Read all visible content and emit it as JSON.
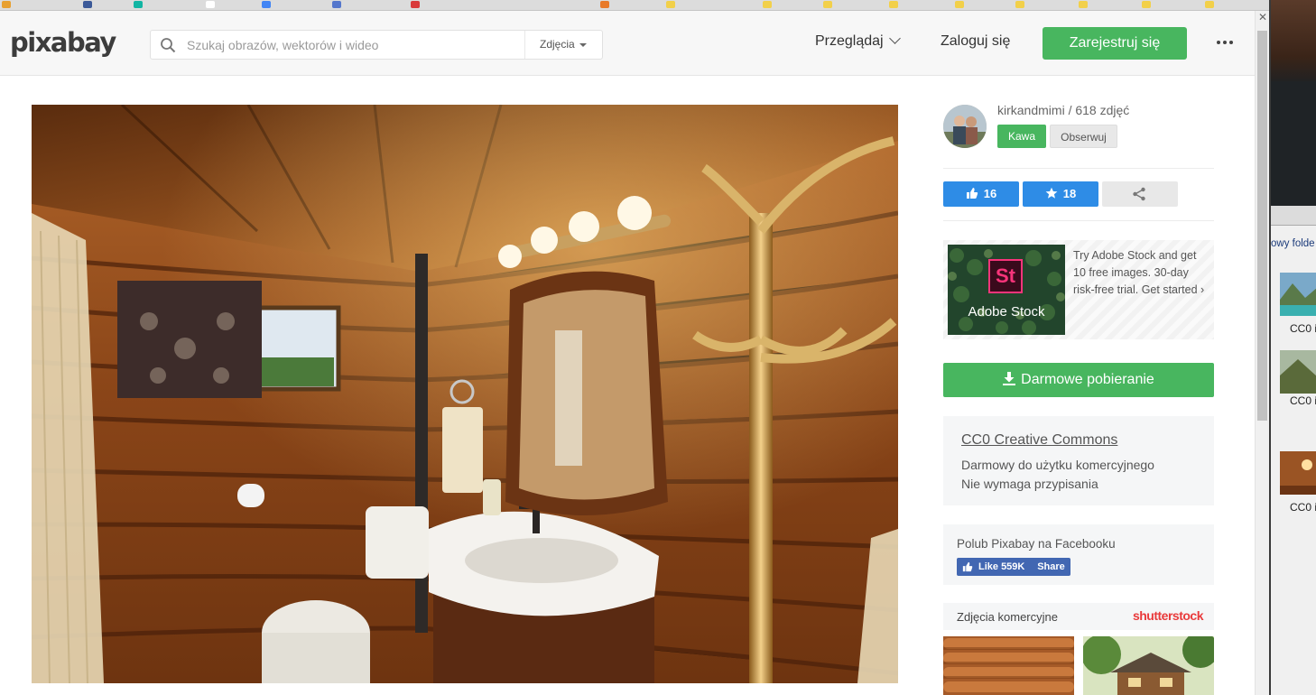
{
  "header": {
    "logo": "pixabay",
    "search_placeholder": "Szukaj obrazów, wektorów i wideo",
    "search_type": "Zdjęcia",
    "browse": "Przeglądaj",
    "login": "Zaloguj się",
    "register": "Zarejestruj się"
  },
  "author": {
    "line": "kirkandmimi / 618 zdjęć",
    "coffee": "Kawa",
    "follow": "Obserwuj"
  },
  "stats": {
    "likes": "16",
    "favorites": "18"
  },
  "ad": {
    "logo_mark": "St",
    "brand": "Adobe Stock",
    "text": "Try Adobe Stock and get 10 free images. 30-day risk-free trial. Get started ›"
  },
  "download": {
    "label": "Darmowe pobieranie"
  },
  "license": {
    "title": "CC0 Creative Commons",
    "line1": "Darmowy do użytku komercyjnego",
    "line2": "Nie wymaga przypisania"
  },
  "facebook": {
    "text": "Polub Pixabay na Facebooku",
    "like": "Like 559K",
    "share": "Share"
  },
  "commercial": {
    "label": "Zdjęcia komercyjne",
    "brand": "shutterstock"
  },
  "side_window": {
    "folder": "owy folde",
    "labels": [
      "CC0 i",
      "CC0 i",
      "CC0 i"
    ]
  },
  "colors": {
    "green": "#48b65f",
    "blue": "#2e8ce6",
    "facebook": "#4267b2",
    "shutterstock": "#e93a3b",
    "adobe_pink": "#f7347a"
  }
}
